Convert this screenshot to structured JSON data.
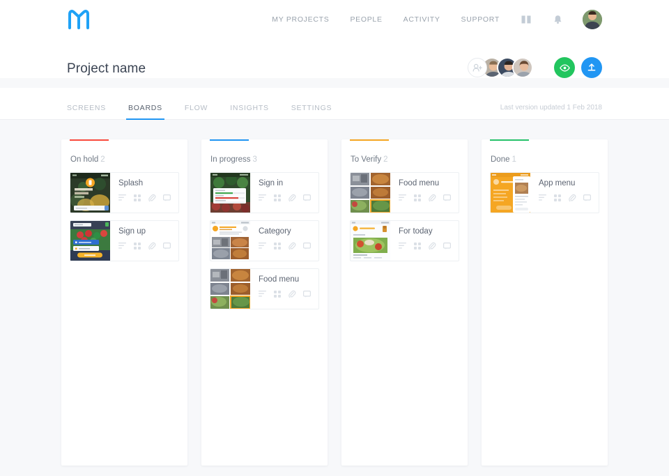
{
  "topnav": {
    "logo_name": "brand-logo",
    "links": [
      "MY PROJECTS",
      "PEOPLE",
      "ACTIVITY",
      "SUPPORT"
    ],
    "icons": [
      "book-icon",
      "bell-icon"
    ],
    "avatar": "user-avatar"
  },
  "project": {
    "title": "Project name",
    "add_person_label": "",
    "preview_label": "",
    "upload_label": ""
  },
  "tabs": {
    "items": [
      {
        "label": "SCREENS",
        "active": false
      },
      {
        "label": "BOARDS",
        "active": true
      },
      {
        "label": "FLOW",
        "active": false
      },
      {
        "label": "INSIGHTS",
        "active": false
      },
      {
        "label": "SETTINGS",
        "active": false
      }
    ],
    "last_updated": "Last version updated 1 Feb 2018"
  },
  "board": {
    "columns": [
      {
        "title": "On hold",
        "count": "2",
        "color": "#f94b3d",
        "cards": [
          {
            "title": "Splash",
            "thumb": "splash-dark-food"
          },
          {
            "title": "Sign up",
            "thumb": "signup-form"
          }
        ]
      },
      {
        "title": "In progress",
        "count": "3",
        "color": "#2196f3",
        "cards": [
          {
            "title": "Sign in",
            "thumb": "signin-list"
          },
          {
            "title": "Category",
            "thumb": "category-grid"
          },
          {
            "title": "Food menu",
            "thumb": "food-grid"
          }
        ]
      },
      {
        "title": "To Verify",
        "count": "2",
        "color": "#f5a623",
        "cards": [
          {
            "title": "Food menu",
            "thumb": "food-grid"
          },
          {
            "title": "For today",
            "thumb": "for-today-card"
          }
        ]
      },
      {
        "title": "Done",
        "count": "1",
        "color": "#27c26a",
        "cards": [
          {
            "title": "App menu",
            "thumb": "app-menu-orange"
          }
        ]
      }
    ],
    "card_icons": [
      "list-icon",
      "grid-icon",
      "attachment-icon",
      "comment-icon"
    ]
  },
  "colors": {
    "accent_blue": "#2196f3",
    "green": "#22c55e",
    "page_bg": "#f7f8fa"
  }
}
